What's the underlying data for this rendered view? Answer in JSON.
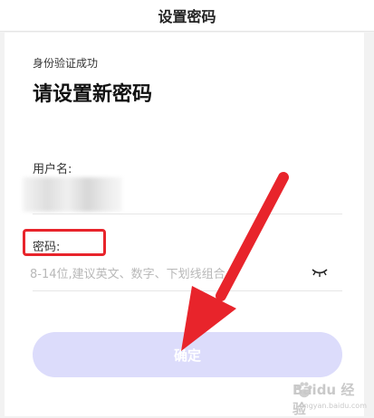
{
  "header": {
    "title": "设置密码"
  },
  "main": {
    "subtitle": "身份验证成功",
    "heading": "请设置新密码",
    "username": {
      "label": "用户名:"
    },
    "password": {
      "label": "密码:",
      "placeholder": "8-14位,建议英文、数字、下划线组合",
      "visibility_icon": "eye-closed-icon"
    },
    "confirm_button": {
      "label": "确定"
    }
  },
  "annotations": {
    "highlight_color": "#e8242b",
    "arrow_color": "#e8242b"
  },
  "colors": {
    "button_bg": "#dcdcfb",
    "button_text": "#ffffff"
  },
  "watermark": {
    "name": "Baidu 经验",
    "site": "jingyan.baidu.com"
  }
}
